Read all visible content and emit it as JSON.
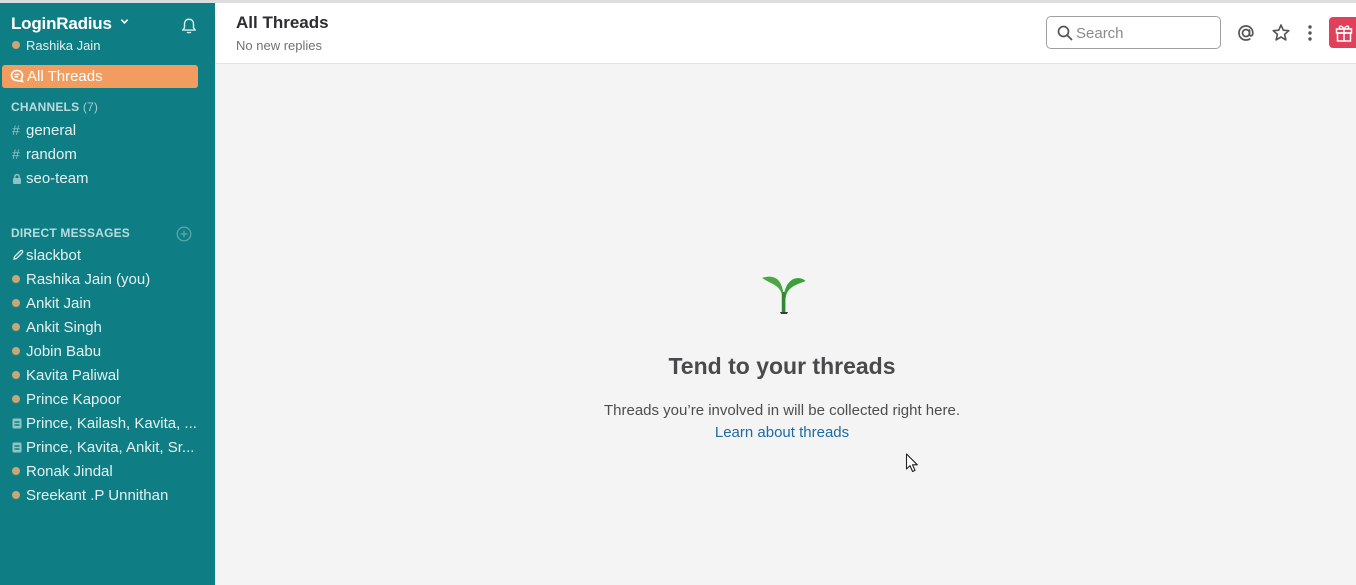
{
  "sidebar": {
    "team_name": "LoginRadius",
    "user_name": "Rashika Jain",
    "all_threads_label": "All Threads",
    "channels_title": "CHANNELS",
    "channels_count": "(7)",
    "channels": [
      {
        "prefix": "#",
        "label": "general"
      },
      {
        "prefix": "#",
        "label": "random"
      },
      {
        "prefix": "lock",
        "label": "seo-team"
      }
    ],
    "dm_title": "DIRECT MESSAGES",
    "dms": [
      {
        "prefix": "pencil",
        "label": "slackbot"
      },
      {
        "prefix": "dot",
        "label": "Rashika Jain (you)"
      },
      {
        "prefix": "dot",
        "label": "Ankit Jain"
      },
      {
        "prefix": "dot",
        "label": "Ankit Singh"
      },
      {
        "prefix": "dot",
        "label": "Jobin Babu"
      },
      {
        "prefix": "dot",
        "label": "Kavita Paliwal"
      },
      {
        "prefix": "dot",
        "label": "Prince Kapoor"
      },
      {
        "prefix": "group",
        "label": "Prince, Kailash, Kavita, ..."
      },
      {
        "prefix": "group",
        "label": "Prince, Kavita, Ankit, Sr..."
      },
      {
        "prefix": "dot",
        "label": "Ronak Jindal"
      },
      {
        "prefix": "dot",
        "label": "Sreekant .P Unnithan"
      }
    ]
  },
  "header": {
    "title": "All Threads",
    "subtitle": "No new replies",
    "search_placeholder": "Search"
  },
  "empty_state": {
    "title": "Tend to your threads",
    "text": "Threads you’re involved in will be collected right here.",
    "link": "Learn about threads"
  },
  "icons": [
    "chevron-down-icon",
    "bell-icon",
    "threads-icon",
    "hash-icon",
    "lock-icon",
    "add-circle-icon",
    "pencil-icon",
    "group-icon",
    "search-icon",
    "at-icon",
    "star-icon",
    "more-vertical-icon",
    "gift-icon",
    "sprout-icon"
  ],
  "colors": {
    "sidebar_bg": "#0f7e84",
    "active_item_bg": "#f39c5f",
    "away_dot": "#c9a678",
    "link": "#1d6aa5",
    "gift_bg": "#e0405a",
    "sprout": "#3aa13a"
  }
}
